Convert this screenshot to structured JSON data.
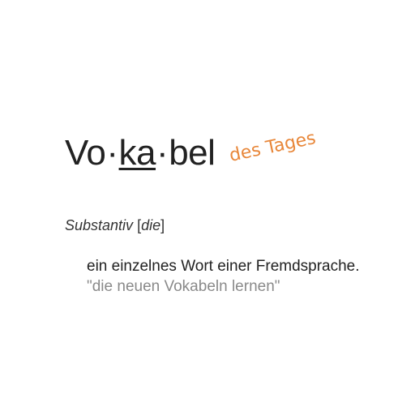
{
  "headword": {
    "syllable_1": "Vo",
    "separator_1": "·",
    "syllable_2": "ka",
    "separator_2": "·",
    "syllable_3": "bel"
  },
  "tag_label": "des Tages",
  "tag_color": "#e8873a",
  "part_of_speech": {
    "word_class": "Substantiv",
    "bracket_open": "[",
    "article": "die",
    "bracket_close": "]"
  },
  "definition": "ein einzelnes Wort einer Fremdsprache.",
  "example": "\"die neuen Vokabeln lernen\""
}
